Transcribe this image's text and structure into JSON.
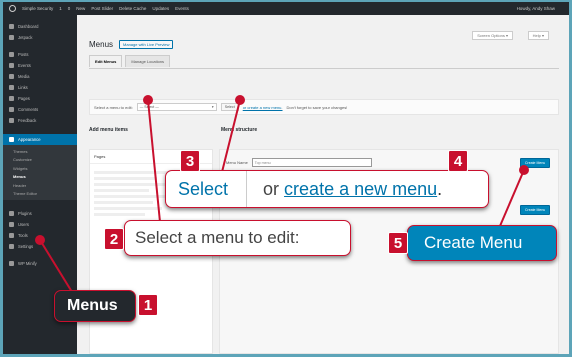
{
  "adminbar": {
    "items": [
      "Simple Security",
      "1",
      "0",
      "New",
      "Post Slider",
      "Delete Cache",
      "Updates",
      "Events"
    ],
    "right": "Howdy, Andy Shaw"
  },
  "sidebar": {
    "items": [
      {
        "label": "Dashboard"
      },
      {
        "label": "Jetpack"
      },
      {
        "label": "Posts"
      },
      {
        "label": "Events"
      },
      {
        "label": "Media"
      },
      {
        "label": "Links"
      },
      {
        "label": "Pages"
      },
      {
        "label": "Comments"
      },
      {
        "label": "Feedback"
      },
      {
        "label": "Appearance"
      }
    ],
    "subitems": [
      "Themes",
      "Customize",
      "Widgets",
      "Menus",
      "Header",
      "Theme Editor"
    ],
    "items_after": [
      {
        "label": "Plugins"
      },
      {
        "label": "Users"
      },
      {
        "label": "Tools"
      },
      {
        "label": "Settings"
      },
      {
        "label": "WP Minify"
      }
    ]
  },
  "header": {
    "title": "Menus",
    "manage_live": "Manage with Live Preview",
    "screen_options": "Screen Options ▾",
    "help": "Help ▾"
  },
  "tabs": [
    "Edit Menus",
    "Manage Locations"
  ],
  "select_row": {
    "label": "Select a menu to edit:",
    "select_value": "— Select —",
    "select_button": "Select",
    "link": "or create a new menu.",
    "note": "Don't forget to save your changes!"
  },
  "left": {
    "title": "Add menu items",
    "section": "Pages"
  },
  "right": {
    "title": "Menu structure",
    "menu_name_label": "Menu Name",
    "menu_name_placeholder": "Top menu",
    "create_button": "Create Menu"
  },
  "callouts": {
    "select_word": "Select",
    "or_text": "or",
    "create_link": "create a new menu",
    "period": ".",
    "edit_label": "Select a menu to edit:",
    "create_button": "Create Menu",
    "menus_label": "Menus",
    "badges": [
      "1",
      "2",
      "3",
      "4",
      "5"
    ]
  },
  "colors": {
    "accent": "#0073aa",
    "button": "#0085ba",
    "callout_red": "#c8102e",
    "sidebar": "#23282d"
  }
}
